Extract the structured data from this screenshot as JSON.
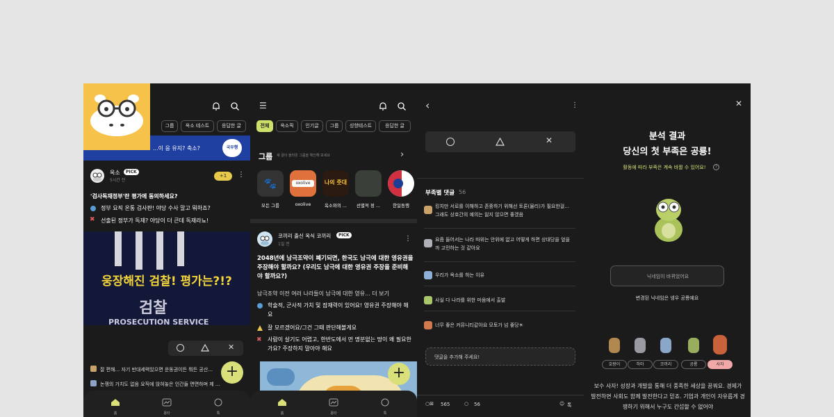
{
  "panel1": {
    "chips": [
      "그룹",
      "옥소 테스트",
      "응답한 글"
    ],
    "banner_text": "...이 응 유지? 축소?",
    "banner_badge": "국우행",
    "post": {
      "author": "옥소",
      "pick": "PICK",
      "time": "5시간 전",
      "points": "+1",
      "title": "'검사독재정부'란 평가에 동의하세요?",
      "option1": "정부 요직 온통 검사판! 야당 수사 말고 뭐하죠?",
      "option2": "선출된 정부가 독재? 야당이 더 큰데 독재라뇨!",
      "image_headline": "웅장해진 검찰! 평가는?!?",
      "image_sign": "검찰",
      "image_sign_en": "PROSECUTION SERVICE"
    },
    "reaction_icons": [
      "circle-icon",
      "triangle-icon",
      "x-icon"
    ],
    "comments": [
      "잘 편해... 자기 반대세력있으면 운동권이든 뭐든 공산...",
      "논쟁의 가치도 없음 요직에 앉혀놓은 인간들 면면하며 제 ..."
    ],
    "fab": "+",
    "nav": [
      "홈",
      "몽타",
      "톡"
    ]
  },
  "panel2": {
    "chips": [
      "전체",
      "옥소픽",
      "인기글",
      "그룹",
      "성향테스트",
      "응답한 글"
    ],
    "group_title": "그룹",
    "group_sub": "새 글이 올라온 그룹을 확인해 보세요",
    "groups": [
      "모든 그룹",
      "oxolive",
      "옥소와의 ...",
      "선별적 정 ...",
      "한일동행"
    ],
    "group_thumb_labels": [
      "oxolive",
      "나의 줏대"
    ],
    "post": {
      "author": "코끼리 출신 옥식 코끼리",
      "pick": "PICK",
      "time": "1일 전",
      "title": "2048년에 남극조약이 폐기되면, 한국도 남극에 대한 영유권을 주장해야 할까요? (우리도 남극에 대한 영유권 주장을 준비해야 할까요?)",
      "body": "남극조약 이전 여러 나라들이 남극에 대한 영유... 더 보기",
      "option1": "학술적, 군사적 가치 및 잠재력이 있어요! 영유권 주장해야 해요",
      "option2": "잘 모르겠어요/그건 그때 판단해볼게요",
      "option3": "사람이 살기도 어렵고, 한반도에서 먼 명분없는 땅이 왜 필요한가요? 주장하지 말아야 해요"
    },
    "fab": "+",
    "nav": [
      "홈",
      "몽타",
      "톡"
    ]
  },
  "panel3": {
    "reaction_icons": [
      "circle-icon",
      "triangle-icon",
      "x-icon"
    ],
    "section_title": "부족별 댓글",
    "count": "56",
    "comments": [
      "킹치만 서로를 이해하고 존중하기 위해선 토론(물리)가 필요한걸... 그래도 상호간의 예의는 잃지 않으면 좋겠음",
      "요즘 들어서는 나라 따위는 안위에 없고 어떻게 하면 상대당을 엎을까 고민하는 것 같아요",
      "우리가 옥소를 하는 이유",
      "사실 다 나라를 위한 마음에서 출발",
      "너무 좋은 커뮤니티같아요 모토가 넘 좋당☀"
    ],
    "comment_input_placeholder": "댓글을 추가해 주세요!",
    "footer_votes": "565",
    "footer_comments": "56",
    "footer_talk": "톡"
  },
  "panel4": {
    "title_line1": "분석 결과",
    "title_line2": "당신의 첫 부족은 공룡!",
    "subtitle": "활동에 따라 부족은 계속 바뀔 수 있어요!",
    "nickname_box": "닉네임이 바뀌었어요",
    "nickname_changed": "변경된 닉네임은 넹우 공룡예요",
    "tribes": [
      "호랑이",
      "하마",
      "코끼리",
      "공룡",
      "사자"
    ],
    "description": "보수 사자! 성장과 개발을 통해 더 풍족한 세상을 꿈꿔요. 경제가 발전하면 사회도 함께 발전한다고 믿죠. 기업과 개인이 자유롭게 경쟁하기 위해서 누구도 간섭할 수 없어야"
  },
  "colors": {
    "accent": "#d9e07a",
    "panel_bg": "#1b1b1b",
    "hippo_bg": "#f6c24a"
  }
}
